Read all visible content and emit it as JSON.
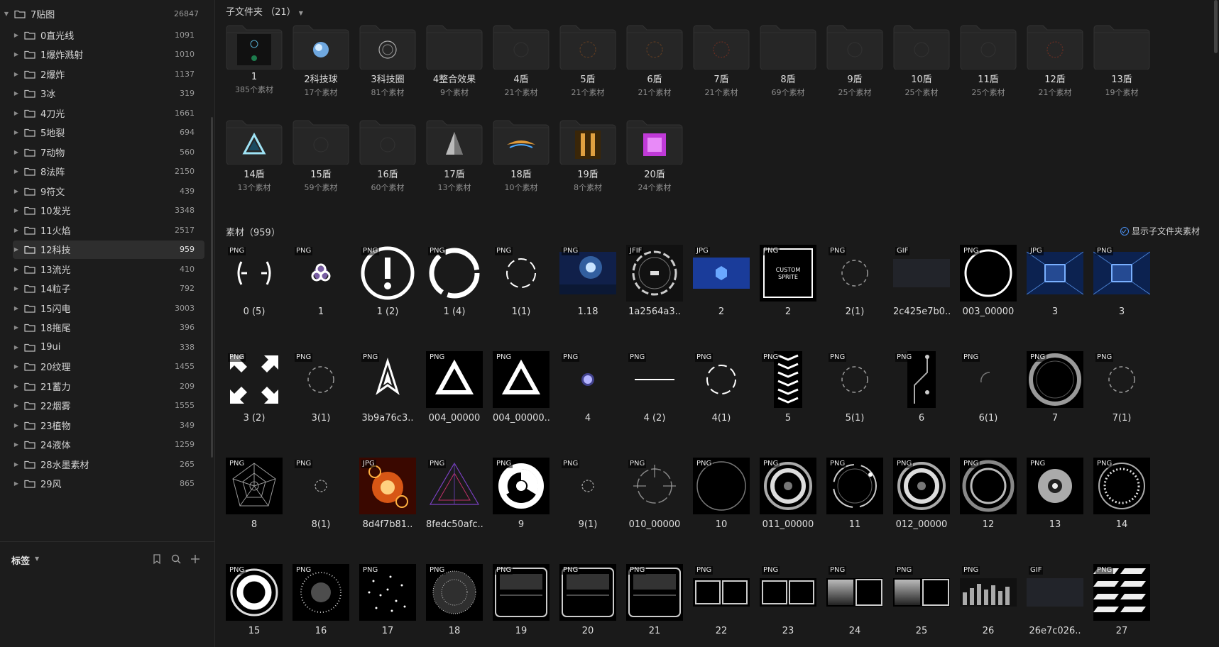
{
  "colors": {
    "bg": "#1a1a1a",
    "sidebar_bg": "#1c1c1c",
    "selected_bg": "#2e2e2e",
    "accent": "#4a8ff0",
    "folder_fill": "#262626"
  },
  "sidebar": {
    "root": {
      "label": "7贴图",
      "count": "26847"
    },
    "items": [
      {
        "label": "0直光线",
        "count": "1091"
      },
      {
        "label": "1爆炸溅射",
        "count": "1010"
      },
      {
        "label": "2爆炸",
        "count": "1137"
      },
      {
        "label": "3冰",
        "count": "319"
      },
      {
        "label": "4刀光",
        "count": "1661"
      },
      {
        "label": "5地裂",
        "count": "694"
      },
      {
        "label": "7动物",
        "count": "560"
      },
      {
        "label": "8法阵",
        "count": "2150"
      },
      {
        "label": "9符文",
        "count": "439"
      },
      {
        "label": "10发光",
        "count": "3348"
      },
      {
        "label": "11火焰",
        "count": "2517"
      },
      {
        "label": "12科技",
        "count": "959",
        "selected": true
      },
      {
        "label": "13流光",
        "count": "410"
      },
      {
        "label": "14粒子",
        "count": "792"
      },
      {
        "label": "15闪电",
        "count": "3003"
      },
      {
        "label": "18拖尾",
        "count": "396"
      },
      {
        "label": "19ui",
        "count": "338"
      },
      {
        "label": "20纹理",
        "count": "1455"
      },
      {
        "label": "21蓄力",
        "count": "209"
      },
      {
        "label": "22烟雾",
        "count": "1555"
      },
      {
        "label": "23植物",
        "count": "349"
      },
      {
        "label": "24液体",
        "count": "1259"
      },
      {
        "label": "28水墨素材",
        "count": "265"
      },
      {
        "label": "29风",
        "count": "865"
      }
    ],
    "tags_label": "标签",
    "tool_icons": [
      "bookmark-icon",
      "search-icon",
      "plus-icon"
    ]
  },
  "subfolders": {
    "header": "子文件夹 （21）",
    "items": [
      {
        "name": "1",
        "count": "385个素材",
        "preview": "small-ring"
      },
      {
        "name": "2科技球",
        "count": "17个素材",
        "preview": "blue-orb"
      },
      {
        "name": "3科技圈",
        "count": "81个素材",
        "preview": "white-ring"
      },
      {
        "name": "4整合效果",
        "count": "9个素材",
        "preview": "none"
      },
      {
        "name": "4盾",
        "count": "21个素材",
        "preview": "faint"
      },
      {
        "name": "5盾",
        "count": "21个素材",
        "preview": "faint-orange"
      },
      {
        "name": "6盾",
        "count": "21个素材",
        "preview": "faint-orange"
      },
      {
        "name": "7盾",
        "count": "21个素材",
        "preview": "faint-red"
      },
      {
        "name": "8盾",
        "count": "69个素材",
        "preview": "none"
      },
      {
        "name": "9盾",
        "count": "25个素材",
        "preview": "faint"
      },
      {
        "name": "10盾",
        "count": "25个素材",
        "preview": "faint"
      },
      {
        "name": "11盾",
        "count": "25个素材",
        "preview": "faint"
      },
      {
        "name": "12盾",
        "count": "21个素材",
        "preview": "faint-red"
      },
      {
        "name": "13盾",
        "count": "19个素材",
        "preview": "none"
      },
      {
        "name": "14盾",
        "count": "13个素材",
        "preview": "blue-triangle"
      },
      {
        "name": "15盾",
        "count": "59个素材",
        "preview": "faint"
      },
      {
        "name": "16盾",
        "count": "60个素材",
        "preview": "faint"
      },
      {
        "name": "17盾",
        "count": "13个素材",
        "preview": "pyramid"
      },
      {
        "name": "18盾",
        "count": "10个素材",
        "preview": "wings"
      },
      {
        "name": "19盾",
        "count": "8个素材",
        "preview": "gold-emblem"
      },
      {
        "name": "20盾",
        "count": "24个素材",
        "preview": "purple-cube"
      }
    ]
  },
  "assets": {
    "header": "素材（959）",
    "show_subfolder_label": "显示子文件夹素材",
    "items": [
      {
        "name": "0 (5)",
        "type": "PNG",
        "art": "brackets"
      },
      {
        "name": "1",
        "type": "PNG",
        "art": "triskelion"
      },
      {
        "name": "1 (2)",
        "type": "PNG",
        "art": "exclaim-ring"
      },
      {
        "name": "1 (4)",
        "type": "PNG",
        "art": "thick-ring"
      },
      {
        "name": "1(1)",
        "type": "PNG",
        "art": "dashed-ring"
      },
      {
        "name": "1.18",
        "type": "PNG",
        "art": "blue-scene"
      },
      {
        "name": "1a2564a3..",
        "type": "JFIF",
        "art": "hud-circle"
      },
      {
        "name": "2",
        "type": "JPG",
        "art": "blue-hex"
      },
      {
        "name": "2",
        "type": "PNG",
        "art": "custom-sprite"
      },
      {
        "name": "2(1)",
        "type": "PNG",
        "art": "thin-dashed-ring"
      },
      {
        "name": "2c425e7b0..",
        "type": "GIF",
        "art": "dark-rect"
      },
      {
        "name": "003_00000",
        "type": "PNG",
        "art": "white-circle"
      },
      {
        "name": "3",
        "type": "JPG",
        "art": "blue-tunnel"
      },
      {
        "name": "3",
        "type": "PNG",
        "art": "blue-tunnel"
      },
      {
        "name": "3 (2)",
        "type": "PNG",
        "art": "arrows"
      },
      {
        "name": "3(1)",
        "type": "PNG",
        "art": "thin-dashed-ring"
      },
      {
        "name": "3b9a76c3..",
        "type": "PNG",
        "art": "flame-logo"
      },
      {
        "name": "004_00000",
        "type": "PNG",
        "art": "glow-triangle"
      },
      {
        "name": "004_00000..",
        "type": "PNG",
        "art": "glow-triangle"
      },
      {
        "name": "4",
        "type": "PNG",
        "art": "dot"
      },
      {
        "name": "4 (2)",
        "type": "PNG",
        "art": "line"
      },
      {
        "name": "4(1)",
        "type": "PNG",
        "art": "dashed-ring"
      },
      {
        "name": "5",
        "type": "PNG",
        "art": "chevrons"
      },
      {
        "name": "5(1)",
        "type": "PNG",
        "art": "thin-dashed-ring"
      },
      {
        "name": "6",
        "type": "PNG",
        "art": "circuit"
      },
      {
        "name": "6(1)",
        "type": "PNG",
        "art": "arc"
      },
      {
        "name": "7",
        "type": "PNG",
        "art": "gray-ring"
      },
      {
        "name": "7(1)",
        "type": "PNG",
        "art": "thin-dashed-ring"
      },
      {
        "name": "8",
        "type": "PNG",
        "art": "web"
      },
      {
        "name": "8(1)",
        "type": "PNG",
        "art": "tiny-ring"
      },
      {
        "name": "8d4f7b81..",
        "type": "JPG",
        "art": "fire-gears"
      },
      {
        "name": "8fedc50afc..",
        "type": "PNG",
        "art": "purple-triangle"
      },
      {
        "name": "9",
        "type": "PNG",
        "art": "radiation"
      },
      {
        "name": "9(1)",
        "type": "PNG",
        "art": "tiny-ring"
      },
      {
        "name": "010_00000",
        "type": "PNG",
        "art": "crosshair"
      },
      {
        "name": "10",
        "type": "PNG",
        "art": "thin-circle"
      },
      {
        "name": "011_00000",
        "type": "PNG",
        "art": "tri-ring"
      },
      {
        "name": "11",
        "type": "PNG",
        "art": "orbit-ring"
      },
      {
        "name": "012_00000",
        "type": "PNG",
        "art": "tri-ring"
      },
      {
        "name": "12",
        "type": "PNG",
        "art": "double-ring"
      },
      {
        "name": "13",
        "type": "PNG",
        "art": "speaker"
      },
      {
        "name": "14",
        "type": "PNG",
        "art": "dotted-ring"
      },
      {
        "name": "15",
        "type": "PNG",
        "art": "bold-ring"
      },
      {
        "name": "16",
        "type": "PNG",
        "art": "particles-ring"
      },
      {
        "name": "17",
        "type": "PNG",
        "art": "particles"
      },
      {
        "name": "18",
        "type": "PNG",
        "art": "particles-dense"
      },
      {
        "name": "19",
        "type": "PNG",
        "art": "frame"
      },
      {
        "name": "20",
        "type": "PNG",
        "art": "frame"
      },
      {
        "name": "21",
        "type": "PNG",
        "art": "frame"
      },
      {
        "name": "22",
        "type": "PNG",
        "art": "panel"
      },
      {
        "name": "23",
        "type": "PNG",
        "art": "panel"
      },
      {
        "name": "24",
        "type": "PNG",
        "art": "panel-gradient"
      },
      {
        "name": "25",
        "type": "PNG",
        "art": "panel-gradient"
      },
      {
        "name": "26",
        "type": "PNG",
        "art": "bars"
      },
      {
        "name": "26e7c026..",
        "type": "GIF",
        "art": "dark-rect"
      },
      {
        "name": "27",
        "type": "PNG",
        "art": "stripes"
      }
    ]
  }
}
